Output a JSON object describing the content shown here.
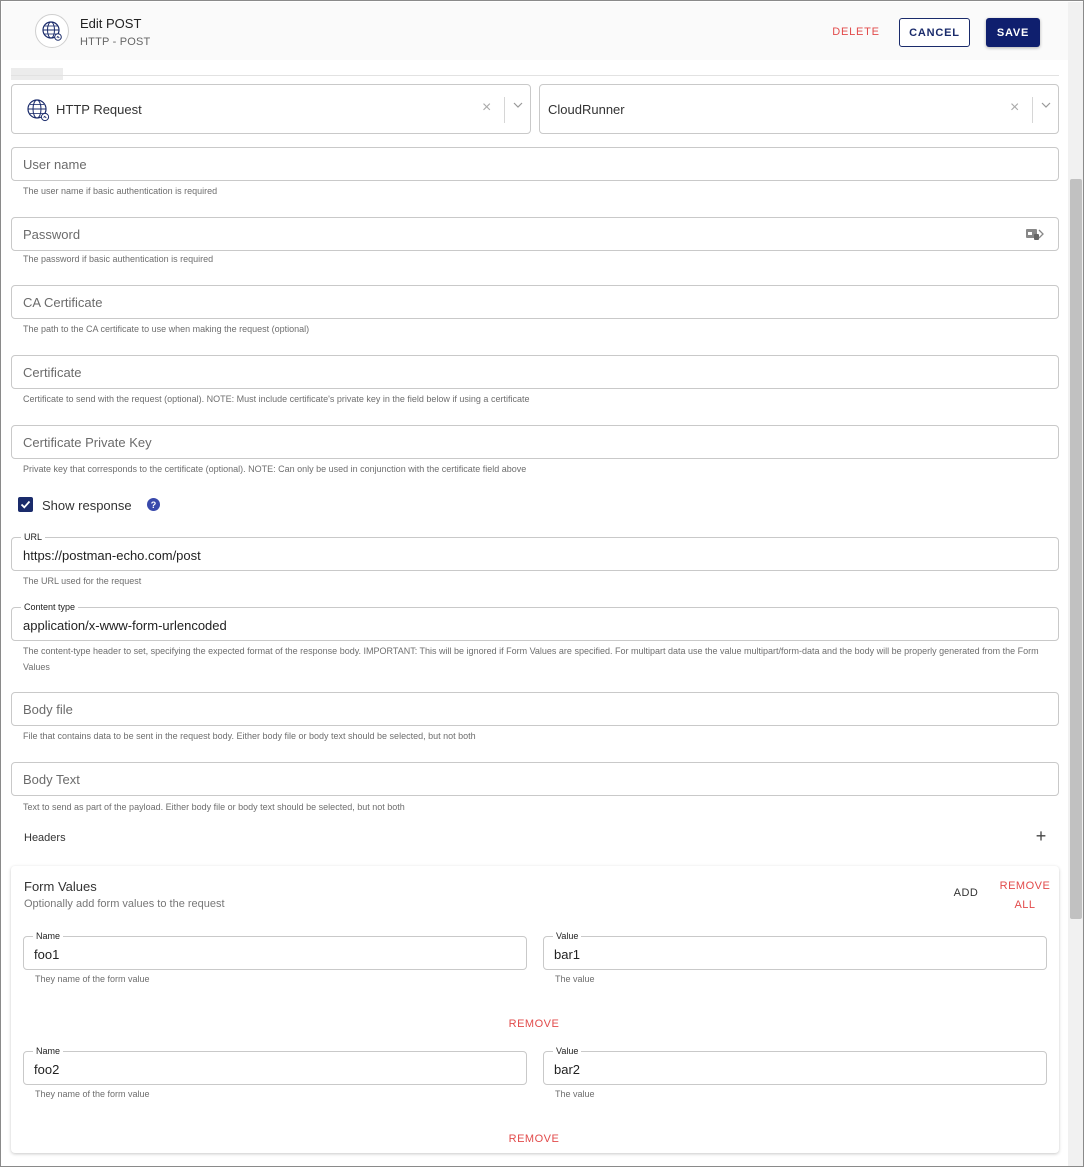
{
  "header": {
    "title": "Edit POST",
    "subtitle": "HTTP - POST",
    "delete_label": "DELETE",
    "cancel_label": "CANCEL",
    "save_label": "SAVE",
    "icon": "globe-icon"
  },
  "selects": {
    "type": {
      "value": "HTTP Request",
      "icon": "globe-icon"
    },
    "runner": {
      "value": "CloudRunner"
    }
  },
  "fields": {
    "username": {
      "placeholder": "User name",
      "help": "The user name if basic authentication is required"
    },
    "password": {
      "placeholder": "Password",
      "help": "The password if basic authentication is required"
    },
    "ca_certificate": {
      "placeholder": "CA Certificate",
      "help": "The path to the CA certificate to use when making the request (optional)"
    },
    "certificate": {
      "placeholder": "Certificate",
      "help": "Certificate to send with the request (optional). NOTE: Must include certificate's private key in the field below if using a certificate"
    },
    "private_key": {
      "placeholder": "Certificate Private Key",
      "help": "Private key that corresponds to the certificate (optional). NOTE: Can only be used in conjunction with the certificate field above"
    },
    "url": {
      "label": "URL",
      "value": "https://postman-echo.com/post",
      "help": "The URL used for the request"
    },
    "content_type": {
      "label": "Content type",
      "value": "application/x-www-form-urlencoded",
      "help": "The content-type header to set, specifying the expected format of the response body. IMPORTANT: This will be ignored if Form Values are specified. For multipart data use the value multipart/form-data and the body will be properly generated from the Form Values"
    },
    "body_file": {
      "placeholder": "Body file",
      "help": "File that contains data to be sent in the request body. Either body file or body text should be selected, but not both"
    },
    "body_text": {
      "placeholder": "Body Text",
      "help": "Text to send as part of the payload. Either body file or body text should be selected, but not both"
    }
  },
  "show_response": {
    "label": "Show response",
    "checked": true,
    "help_icon": "?"
  },
  "headers": {
    "label": "Headers",
    "add_icon": "+"
  },
  "form_values": {
    "title": "Form Values",
    "subtitle": "Optionally add form values to the request",
    "add_label": "ADD",
    "remove_all_label": "REMOVE ALL",
    "items": [
      {
        "name_label": "Name",
        "name": "foo1",
        "name_help": "They name of the form value",
        "value_label": "Value",
        "value": "bar1",
        "value_help": "The value",
        "remove_label": "REMOVE"
      },
      {
        "name_label": "Name",
        "name": "foo2",
        "name_help": "They name of the form value",
        "value_label": "Value",
        "value": "bar2",
        "value_help": "The value",
        "remove_label": "REMOVE"
      }
    ]
  },
  "colors": {
    "primary": "#0f1f6e",
    "danger": "#e24b4b",
    "border": "#c9c9c9"
  }
}
